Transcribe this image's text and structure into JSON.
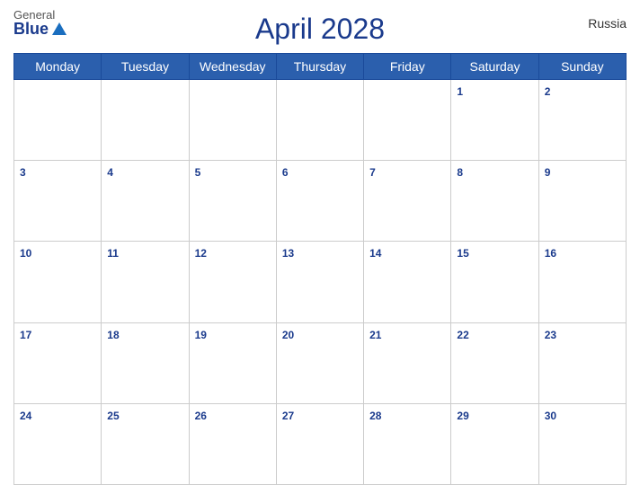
{
  "header": {
    "title": "April 2028",
    "country": "Russia",
    "logo": {
      "general": "General",
      "blue": "Blue"
    }
  },
  "weekdays": [
    "Monday",
    "Tuesday",
    "Wednesday",
    "Thursday",
    "Friday",
    "Saturday",
    "Sunday"
  ],
  "weeks": [
    [
      null,
      null,
      null,
      null,
      null,
      1,
      2
    ],
    [
      3,
      4,
      5,
      6,
      7,
      8,
      9
    ],
    [
      10,
      11,
      12,
      13,
      14,
      15,
      16
    ],
    [
      17,
      18,
      19,
      20,
      21,
      22,
      23
    ],
    [
      24,
      25,
      26,
      27,
      28,
      29,
      30
    ]
  ]
}
